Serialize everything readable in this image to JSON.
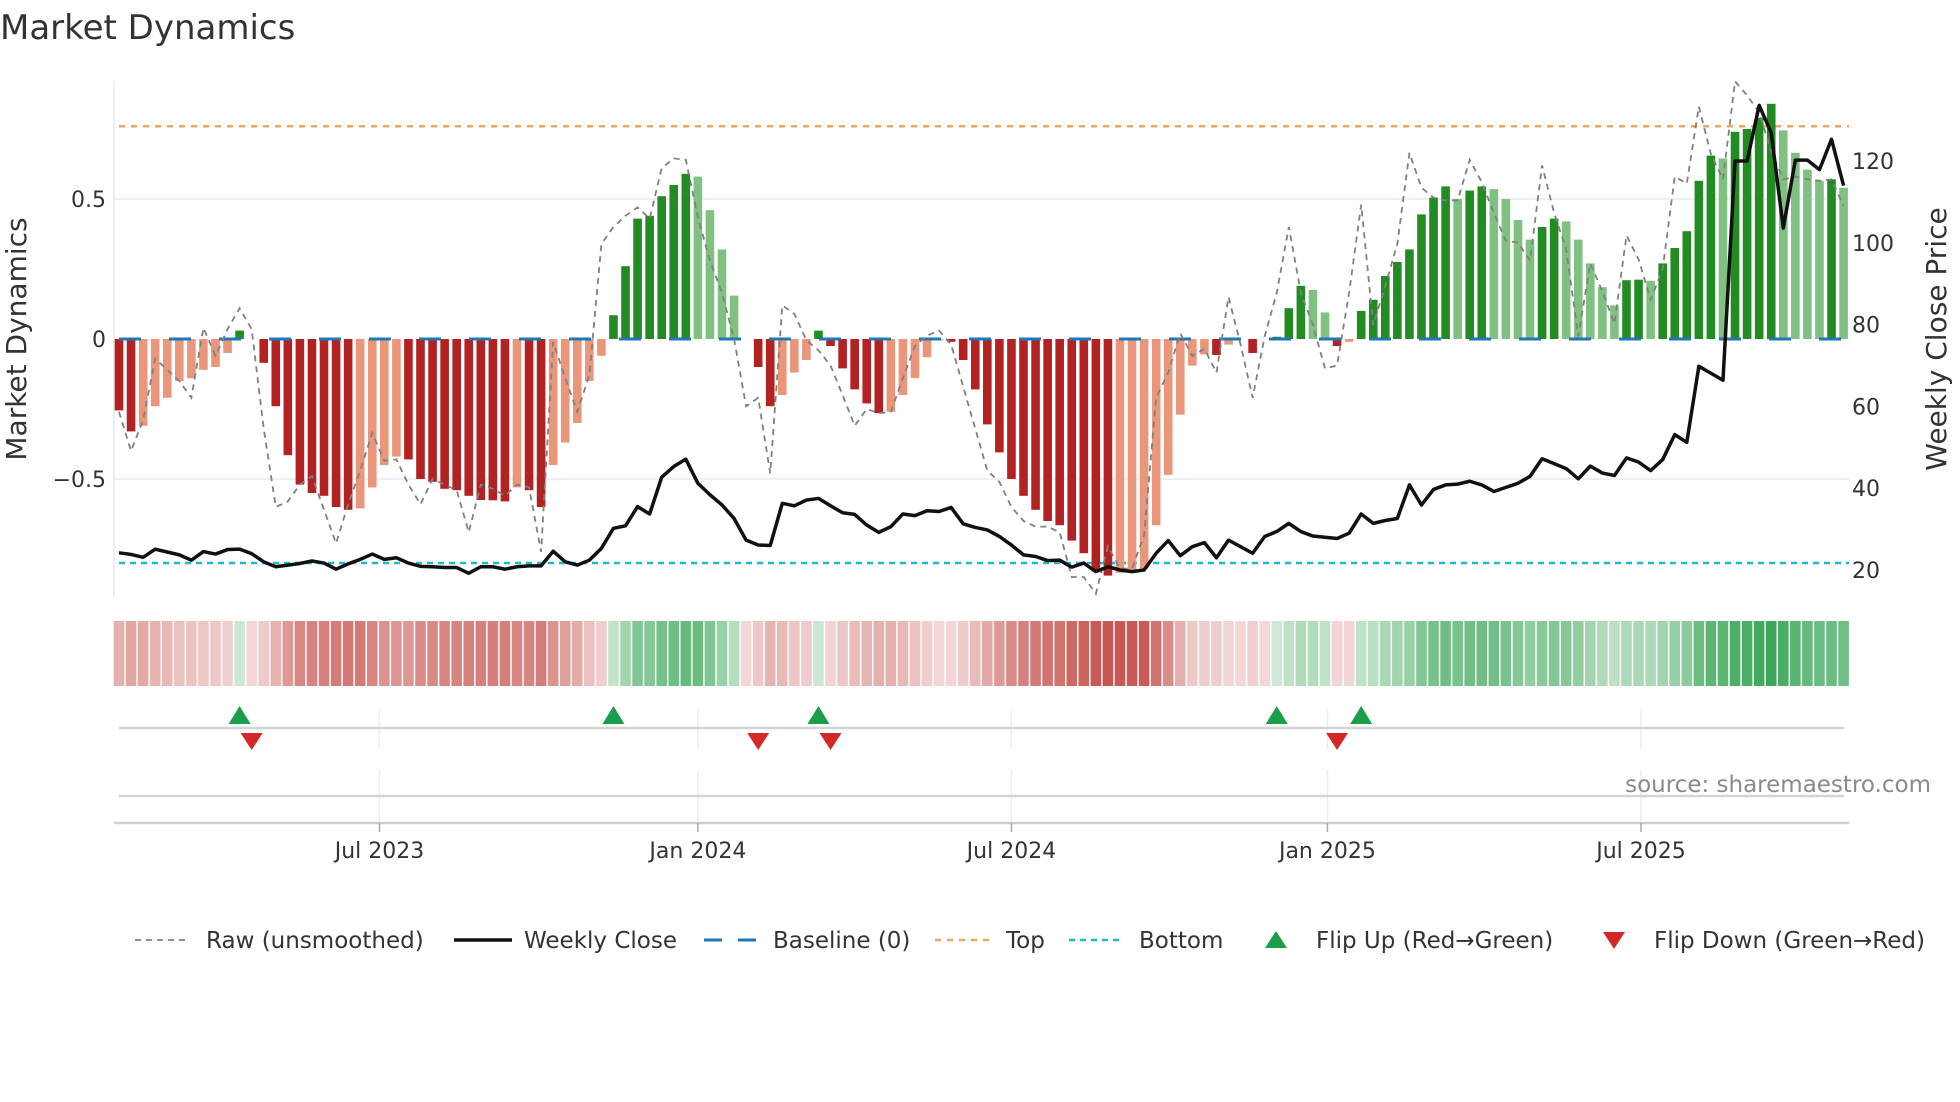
{
  "title": "Market Dynamics",
  "source": "source: sharemaestro.com",
  "chart_data": {
    "type": "bar",
    "title": "Market Dynamics",
    "ylabel": "Market Dynamics",
    "ylabel_right": "Weekly Close Price",
    "xlabel": "",
    "ylim": [
      -0.92,
      0.92
    ],
    "ylim_right": [
      12,
      137
    ],
    "grid": true,
    "legend_placement": "bottom",
    "x_unit": "week index",
    "y_ticks": [
      {
        "label": "0.5",
        "value": 0.5
      },
      {
        "label": "0",
        "value": 0
      },
      {
        "label": "−0.5",
        "value": -0.5
      }
    ],
    "y_ticks_right": [
      {
        "label": "120",
        "value": 120
      },
      {
        "label": "100",
        "value": 100
      },
      {
        "label": "80",
        "value": 80
      },
      {
        "label": "60",
        "value": 60
      },
      {
        "label": "40",
        "value": 40
      },
      {
        "label": "20",
        "value": 20
      }
    ],
    "x_ticks": [
      {
        "label": "Jul 2023",
        "week": 21.6
      },
      {
        "label": "Jan 2024",
        "week": 48.0
      },
      {
        "label": "Jul 2024",
        "week": 74.0
      },
      {
        "label": "Jan 2025",
        "week": 100.2
      },
      {
        "label": "Jul 2025",
        "week": 126.2
      }
    ],
    "reference_lines": {
      "baseline": 0,
      "top": 0.76,
      "bottom": -0.8
    },
    "colors": {
      "bar_up_strong": "#228b22",
      "bar_up_weak": "#80c080",
      "bar_down_strong": "#b22222",
      "bar_down_weak": "#e9967a",
      "raw": "#808080",
      "close": "#111111",
      "baseline": "#1f77b4",
      "top": "#f4a460",
      "bottom": "#17becf",
      "flip_up": "#1a9e4a",
      "flip_down": "#d62728"
    },
    "series": [
      {
        "name": "Market Dynamics (smoothed)",
        "values": [
          -0.255,
          -0.33,
          -0.31,
          -0.24,
          -0.21,
          -0.15,
          -0.14,
          -0.11,
          -0.1,
          -0.05,
          0.03,
          0,
          -0.085,
          -0.24,
          -0.415,
          -0.52,
          -0.55,
          -0.56,
          -0.6,
          -0.61,
          -0.605,
          -0.53,
          -0.45,
          -0.42,
          -0.43,
          -0.5,
          -0.51,
          -0.535,
          -0.54,
          -0.56,
          -0.575,
          -0.576,
          -0.58,
          -0.53,
          -0.54,
          -0.6,
          -0.45,
          -0.37,
          -0.3,
          -0.15,
          -0.06,
          0.085,
          0.26,
          0.43,
          0.44,
          0.51,
          0.55,
          0.59,
          0.58,
          0.46,
          0.32,
          0.155,
          0,
          -0.1,
          -0.24,
          -0.2,
          -0.12,
          -0.075,
          0.03,
          -0.025,
          -0.105,
          -0.18,
          -0.23,
          -0.265,
          -0.26,
          -0.2,
          -0.14,
          -0.065,
          -0.005,
          -0.01,
          -0.075,
          -0.18,
          -0.305,
          -0.405,
          -0.5,
          -0.56,
          -0.61,
          -0.65,
          -0.665,
          -0.72,
          -0.765,
          -0.83,
          -0.845,
          -0.835,
          -0.83,
          -0.82,
          -0.665,
          -0.485,
          -0.27,
          -0.095,
          -0.055,
          -0.057,
          -0.02,
          0,
          -0.05,
          0,
          0.008,
          0.11,
          0.19,
          0.175,
          0.095,
          -0.025,
          -0.01,
          0.1,
          0.14,
          0.225,
          0.275,
          0.32,
          0.445,
          0.505,
          0.545,
          0.5,
          0.53,
          0.545,
          0.535,
          0.5,
          0.425,
          0.355,
          0.4,
          0.43,
          0.42,
          0.355,
          0.27,
          0.185,
          0.12,
          0.21,
          0.212,
          0.208,
          0.27,
          0.325,
          0.385,
          0.565,
          0.655,
          0.645,
          0.74,
          0.75,
          0.79,
          0.84,
          0.745,
          0.665,
          0.605,
          0.565,
          0.57,
          0.54
        ]
      },
      {
        "name": "Raw (unsmoothed)",
        "values": [
          -0.26,
          -0.4,
          -0.29,
          -0.07,
          -0.11,
          -0.15,
          -0.21,
          0.04,
          -0.06,
          0.035,
          0.11,
          0.035,
          -0.32,
          -0.6,
          -0.58,
          -0.52,
          -0.49,
          -0.61,
          -0.73,
          -0.59,
          -0.47,
          -0.335,
          -0.435,
          -0.43,
          -0.52,
          -0.59,
          -0.5,
          -0.52,
          -0.54,
          -0.69,
          -0.52,
          -0.535,
          -0.56,
          -0.52,
          -0.53,
          -0.76,
          -0.01,
          -0.14,
          -0.26,
          -0.13,
          0.34,
          0.4,
          0.44,
          0.47,
          0.43,
          0.61,
          0.645,
          0.64,
          0.435,
          0.28,
          0.165,
          0,
          -0.24,
          -0.21,
          -0.48,
          0.12,
          0.09,
          -0.005,
          -0.04,
          -0.095,
          -0.2,
          -0.31,
          -0.25,
          -0.265,
          -0.26,
          -0.14,
          -0.025,
          0.012,
          0.03,
          -0.02,
          -0.17,
          -0.32,
          -0.47,
          -0.51,
          -0.6,
          -0.65,
          -0.67,
          -0.67,
          -0.69,
          -0.85,
          -0.85,
          -0.91,
          -0.74,
          -0.82,
          -0.82,
          -0.7,
          -0.21,
          -0.12,
          0.02,
          -0.06,
          -0.035,
          -0.12,
          0.15,
          -0.02,
          -0.21,
          0.01,
          0.165,
          0.4,
          0.165,
          0.05,
          -0.105,
          -0.095,
          0.165,
          0.48,
          0.05,
          0.19,
          0.34,
          0.665,
          0.54,
          0.505,
          0.495,
          0.495,
          0.64,
          0.56,
          0.45,
          0.35,
          0.345,
          0.28,
          0.62,
          0.45,
          0.32,
          0.01,
          0.27,
          0.17,
          0.055,
          0.37,
          0.285,
          0.14,
          0.25,
          0.58,
          0.555,
          0.83,
          0.66,
          0.57,
          0.92,
          0.87,
          0.81,
          0.67,
          0.57,
          0.58,
          0.57,
          0.565,
          0.57,
          0.475
        ]
      },
      {
        "name": "Weekly Close",
        "axis": "right",
        "values": [
          24.2,
          23.8,
          23.1,
          25.1,
          24.4,
          23.7,
          22.4,
          24.5,
          23.9,
          25.0,
          25.1,
          24.0,
          22.0,
          20.8,
          21.2,
          21.6,
          22.2,
          21.7,
          20.2,
          21.5,
          22.6,
          23.9,
          22.6,
          23.0,
          21.7,
          20.9,
          20.8,
          20.6,
          20.6,
          19.2,
          20.8,
          20.8,
          20.2,
          20.8,
          21.0,
          21.0,
          24.6,
          22.0,
          21.2,
          22.4,
          25.3,
          30.2,
          30.8,
          35.5,
          33.7,
          42.7,
          45.3,
          47.1,
          41.2,
          38.4,
          35.9,
          32.6,
          27.3,
          26.1,
          26.0,
          36.3,
          35.7,
          37.1,
          37.5,
          35.7,
          34.0,
          33.6,
          31.0,
          29.2,
          30.6,
          33.7,
          33.3,
          34.5,
          34.3,
          35.3,
          31.3,
          30.4,
          29.8,
          28.2,
          26.1,
          23.7,
          23.3,
          22.3,
          22.4,
          20.7,
          21.7,
          19.6,
          20.8,
          20.0,
          19.6,
          20.0,
          24.1,
          27.2,
          23.5,
          25.7,
          26.7,
          23.0,
          27.3,
          25.7,
          24.1,
          28.2,
          29.4,
          31.4,
          29.4,
          28.3,
          28.0,
          27.7,
          29.0,
          33.7,
          31.4,
          32.1,
          32.6,
          40.8,
          35.9,
          39.7,
          40.8,
          41.0,
          41.7,
          40.8,
          39.2,
          40.2,
          41.2,
          42.9,
          47.2,
          46.0,
          44.8,
          42.3,
          45.4,
          43.7,
          43.1,
          47.4,
          46.4,
          44.3,
          47.0,
          53.1,
          51.2,
          69.8,
          68.1,
          66.4,
          120,
          120,
          133.6,
          126.9,
          103.6,
          120.2,
          120.2,
          117.9,
          125.3,
          114.0
        ]
      }
    ],
    "flip_up_weeks": [
      10,
      41,
      58,
      96,
      103
    ],
    "flip_down_weeks": [
      11,
      53,
      59,
      101
    ],
    "legend": [
      {
        "key": "raw",
        "label": "Raw (unsmoothed)"
      },
      {
        "key": "close",
        "label": "Weekly Close"
      },
      {
        "key": "baseline",
        "label": "Baseline (0)"
      },
      {
        "key": "top",
        "label": "Top"
      },
      {
        "key": "bottom",
        "label": "Bottom"
      },
      {
        "key": "flip_up",
        "label": "Flip Up (Red→Green)"
      },
      {
        "key": "flip_down",
        "label": "Flip Down (Green→Red)"
      }
    ]
  }
}
